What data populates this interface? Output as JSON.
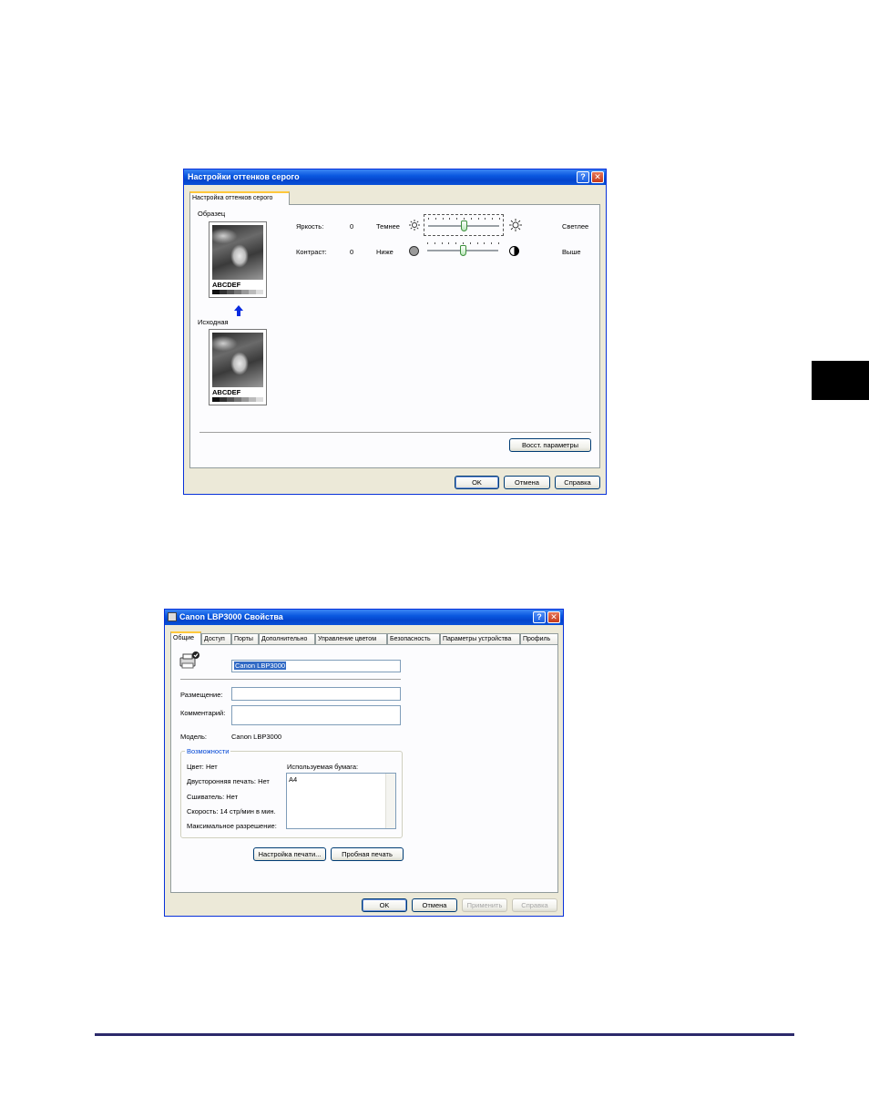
{
  "grayscale_dialog": {
    "title": "Настройки оттенков серого",
    "tab": "Настройка оттенков серого",
    "sample_label": "Образец",
    "original_label": "Исходная",
    "sample_text": "ABCDEF",
    "brightness": {
      "label": "Яркость:",
      "value": "0",
      "left": "Темнее",
      "right": "Светлее",
      "level": 0.5
    },
    "contrast": {
      "label": "Контраст:",
      "value": "0",
      "left": "Ниже",
      "right": "Выше",
      "level": 0.5
    },
    "restore_button": "Восст. параметры",
    "ok_button": "OK",
    "cancel_button": "Отмена",
    "help_button": "Справка"
  },
  "properties_dialog": {
    "title": "Canon LBP3000 Свойства",
    "tabs": [
      "Общие",
      "Доступ",
      "Порты",
      "Дополнительно",
      "Управление цветом",
      "Безопасность",
      "Параметры устройства",
      "Профиль"
    ],
    "printer_name": "Canon LBP3000",
    "location_label": "Размещение:",
    "location_value": "",
    "comment_label": "Комментарий:",
    "comment_value": "",
    "model_label": "Модель:",
    "model_value": "Canon LBP3000",
    "features_title": "Возможности",
    "color": "Цвет: Нет",
    "duplex": "Двусторонняя печать: Нет",
    "staple": "Сшиватель: Нет",
    "speed": "Скорость: 14 стр/мин в мин.",
    "max_res": "Максимальное разрешение:",
    "paper_label": "Используемая бумага:",
    "paper_items": [
      "A4"
    ],
    "print_prefs_button": "Настройка печати...",
    "test_page_button": "Пробная печать",
    "ok_button": "OK",
    "cancel_button": "Отмена",
    "apply_button": "Применить",
    "help_button": "Справка"
  },
  "colors": {
    "accent": "#0831d9",
    "footer_rule": "#2c2a6b",
    "side_tab": "#000000"
  }
}
